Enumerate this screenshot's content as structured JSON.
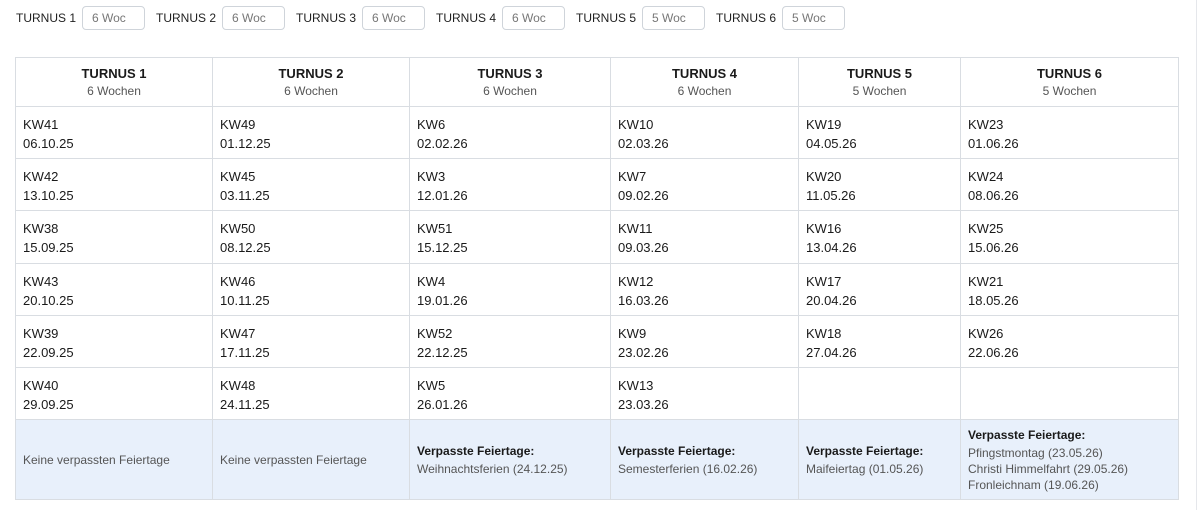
{
  "inputs": [
    {
      "label": "TURNUS 1",
      "value": "6 Woc"
    },
    {
      "label": "TURNUS 2",
      "value": "6 Woc"
    },
    {
      "label": "TURNUS 3",
      "value": "6 Woc"
    },
    {
      "label": "TURNUS 4",
      "value": "6 Woc"
    },
    {
      "label": "TURNUS 5",
      "value": "5 Woc"
    },
    {
      "label": "TURNUS 6",
      "value": "5 Woc"
    }
  ],
  "columns": [
    {
      "title": "TURNUS 1",
      "subtitle": "6 Wochen"
    },
    {
      "title": "TURNUS 2",
      "subtitle": "6 Wochen"
    },
    {
      "title": "TURNUS 3",
      "subtitle": "6 Wochen"
    },
    {
      "title": "TURNUS 4",
      "subtitle": "6 Wochen"
    },
    {
      "title": "TURNUS 5",
      "subtitle": "5 Wochen"
    },
    {
      "title": "TURNUS 6",
      "subtitle": "5 Wochen"
    }
  ],
  "rows": [
    [
      {
        "kw": "KW41",
        "date": "06.10.25"
      },
      {
        "kw": "KW49",
        "date": "01.12.25"
      },
      {
        "kw": "KW6",
        "date": "02.02.26"
      },
      {
        "kw": "KW10",
        "date": "02.03.26"
      },
      {
        "kw": "KW19",
        "date": "04.05.26"
      },
      {
        "kw": "KW23",
        "date": "01.06.26"
      }
    ],
    [
      {
        "kw": "KW42",
        "date": "13.10.25"
      },
      {
        "kw": "KW45",
        "date": "03.11.25"
      },
      {
        "kw": "KW3",
        "date": "12.01.26"
      },
      {
        "kw": "KW7",
        "date": "09.02.26"
      },
      {
        "kw": "KW20",
        "date": "11.05.26"
      },
      {
        "kw": "KW24",
        "date": "08.06.26"
      }
    ],
    [
      {
        "kw": "KW38",
        "date": "15.09.25"
      },
      {
        "kw": "KW50",
        "date": "08.12.25"
      },
      {
        "kw": "KW51",
        "date": "15.12.25"
      },
      {
        "kw": "KW11",
        "date": "09.03.26"
      },
      {
        "kw": "KW16",
        "date": "13.04.26"
      },
      {
        "kw": "KW25",
        "date": "15.06.26"
      }
    ],
    [
      {
        "kw": "KW43",
        "date": "20.10.25"
      },
      {
        "kw": "KW46",
        "date": "10.11.25"
      },
      {
        "kw": "KW4",
        "date": "19.01.26"
      },
      {
        "kw": "KW12",
        "date": "16.03.26"
      },
      {
        "kw": "KW17",
        "date": "20.04.26"
      },
      {
        "kw": "KW21",
        "date": "18.05.26"
      }
    ],
    [
      {
        "kw": "KW39",
        "date": "22.09.25"
      },
      {
        "kw": "KW47",
        "date": "17.11.25"
      },
      {
        "kw": "KW52",
        "date": "22.12.25"
      },
      {
        "kw": "KW9",
        "date": "23.02.26"
      },
      {
        "kw": "KW18",
        "date": "27.04.26"
      },
      {
        "kw": "KW26",
        "date": "22.06.26"
      }
    ],
    [
      {
        "kw": "KW40",
        "date": "29.09.25"
      },
      {
        "kw": "KW48",
        "date": "24.11.25"
      },
      {
        "kw": "KW5",
        "date": "26.01.26"
      },
      {
        "kw": "KW13",
        "date": "23.03.26"
      },
      null,
      null
    ]
  ],
  "holidays": [
    {
      "none": "Keine verpassten Feiertage"
    },
    {
      "none": "Keine verpassten Feiertage"
    },
    {
      "title": "Verpasste Feiertage:",
      "items": [
        "Weihnachtsferien (24.12.25)"
      ]
    },
    {
      "title": "Verpasste Feiertage:",
      "items": [
        "Semesterferien (16.02.26)"
      ]
    },
    {
      "title": "Verpasste Feiertage:",
      "items": [
        "Maifeiertag (01.05.26)"
      ]
    },
    {
      "title": "Verpasste Feiertage:",
      "items": [
        "Pfingstmontag (23.05.26)",
        "Christi Himmelfahrt (29.05.26)",
        "Fronleichnam (19.06.26)"
      ]
    }
  ]
}
